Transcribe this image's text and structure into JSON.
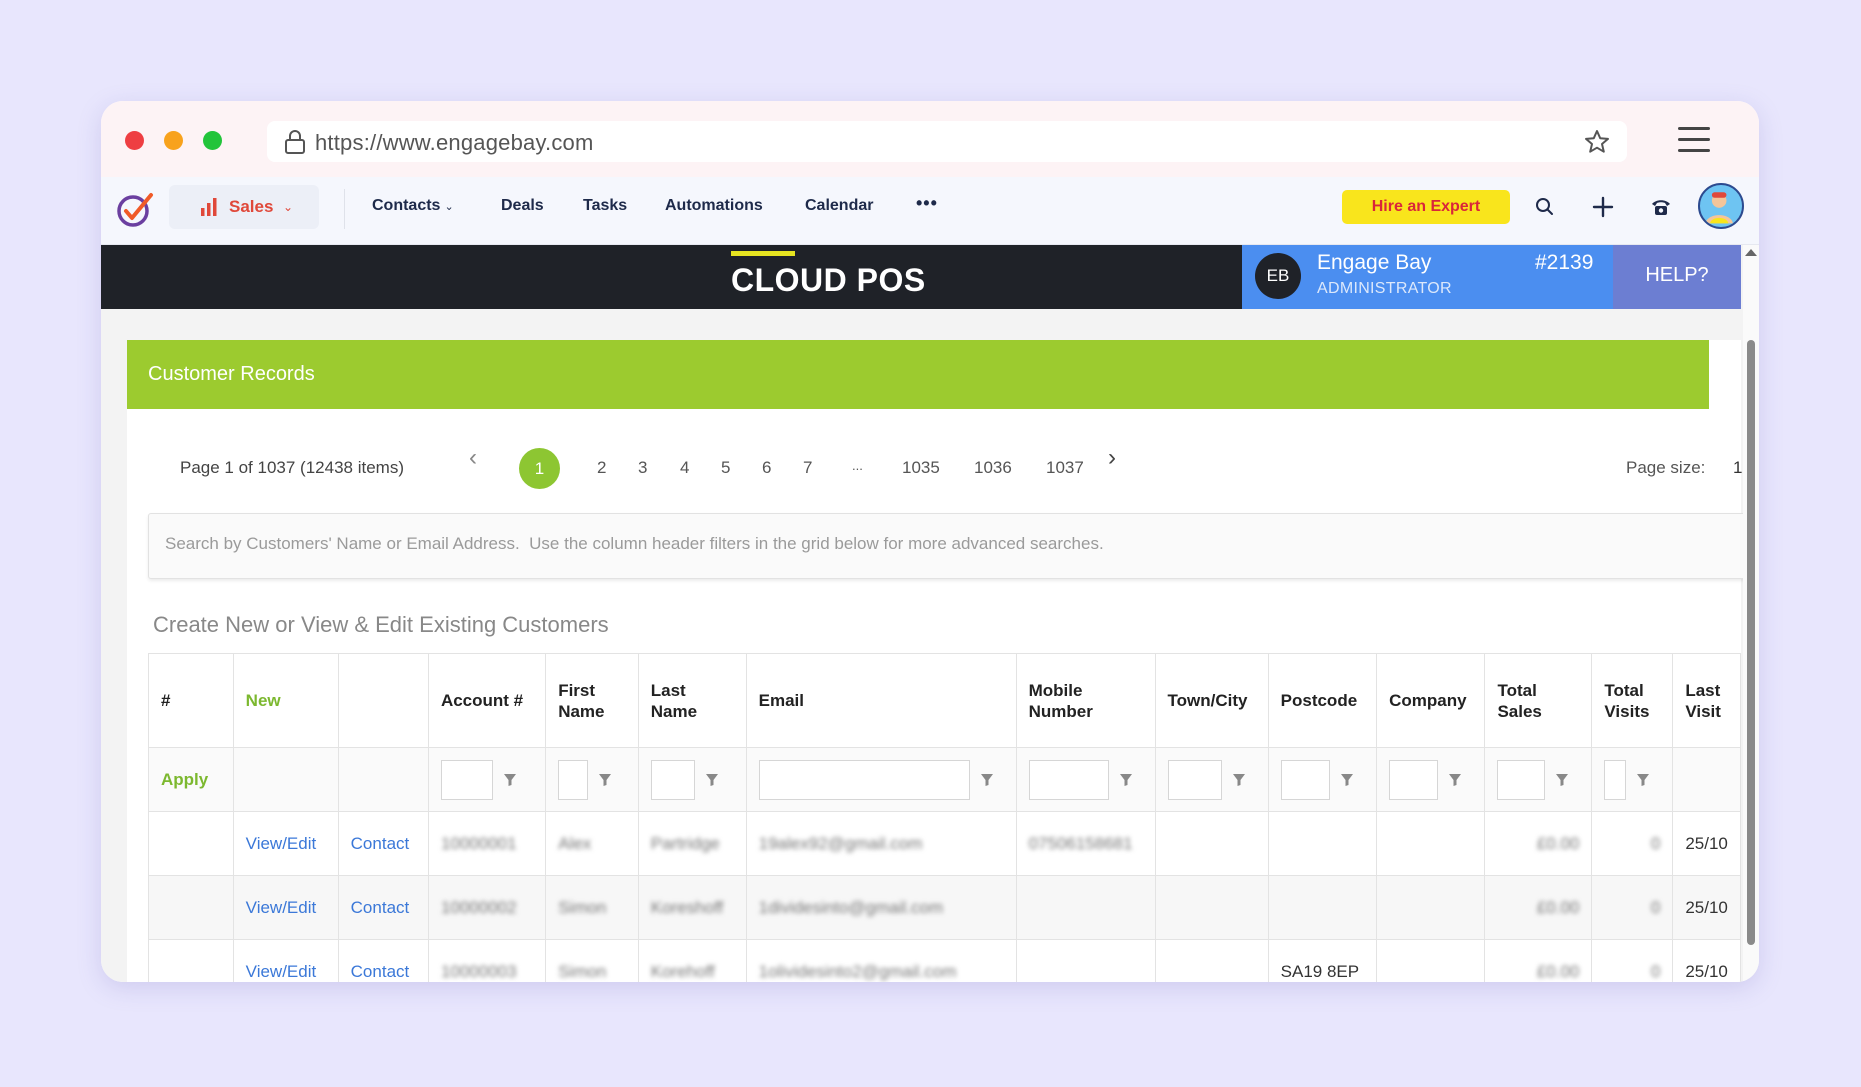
{
  "browser": {
    "url": "https://www.engagebay.com"
  },
  "appnav": {
    "module_label": "Sales",
    "menu": [
      "Contacts",
      "Deals",
      "Tasks",
      "Automations",
      "Calendar"
    ],
    "more_label": "•••",
    "hire_label": "Hire an Expert"
  },
  "pos": {
    "title": "CLOUD POS",
    "user_initials": "EB",
    "user_name": "Engage Bay",
    "user_role": "ADMINISTRATOR",
    "store_id": "#2139",
    "help_label": "HELP?"
  },
  "records": {
    "title": "Customer Records",
    "page_info": "Page 1 of 1037 (12438 items)",
    "pages": [
      "1",
      "2",
      "3",
      "4",
      "5",
      "6",
      "7",
      "...",
      "1035",
      "1036",
      "1037"
    ],
    "current_page": "1",
    "page_size_label": "Page size:",
    "page_size_value": "1",
    "search_placeholder": "Search by Customers' Name or Email Address.  Use the column header filters in the grid below for more advanced searches.",
    "section_title": "Create New or View & Edit Existing Customers",
    "apply_label": "Apply",
    "columns": [
      "#",
      "New",
      "",
      "Account #",
      "First Name",
      "Last Name",
      "Email",
      "Mobile Number",
      "Town/City",
      "Postcode",
      "Company",
      "Total Sales",
      "Total Visits",
      "Last Visit"
    ],
    "rows": [
      {
        "view": "View/Edit",
        "contact": "Contact",
        "account": "10000001",
        "first": "Alex",
        "last": "Partridge",
        "email": "19alex92@gmail.com",
        "mobile": "07506158681",
        "town": "",
        "postcode": "",
        "company": "",
        "sales": "£0.00",
        "visits": "0",
        "last_visit": "25/10"
      },
      {
        "view": "View/Edit",
        "contact": "Contact",
        "account": "10000002",
        "first": "Simon",
        "last": "Koreshoff",
        "email": "1dividesinto@gmail.com",
        "mobile": "",
        "town": "",
        "postcode": "",
        "company": "",
        "sales": "£0.00",
        "visits": "0",
        "last_visit": "25/10"
      },
      {
        "view": "View/Edit",
        "contact": "Contact",
        "account": "10000003",
        "first": "Simon",
        "last": "Korehoff",
        "email": "1olividesinto2@gmail.com",
        "mobile": "",
        "town": "",
        "postcode": "SA19 8EP",
        "company": "",
        "sales": "£0.00",
        "visits": "0",
        "last_visit": "25/10"
      }
    ]
  },
  "colors": {
    "accent_green": "#9ccb2f",
    "link_blue": "#3b78d8",
    "hire_yellow": "#f9e51c",
    "user_blue": "#4b8ef0"
  },
  "icons": [
    "lock-icon",
    "star-icon",
    "hamburger-menu-icon",
    "app-logo-icon",
    "bar-chart-icon",
    "search-icon",
    "plus-icon",
    "phone-icon",
    "avatar",
    "filter-icon",
    "chevron-left-icon",
    "chevron-right-icon"
  ]
}
